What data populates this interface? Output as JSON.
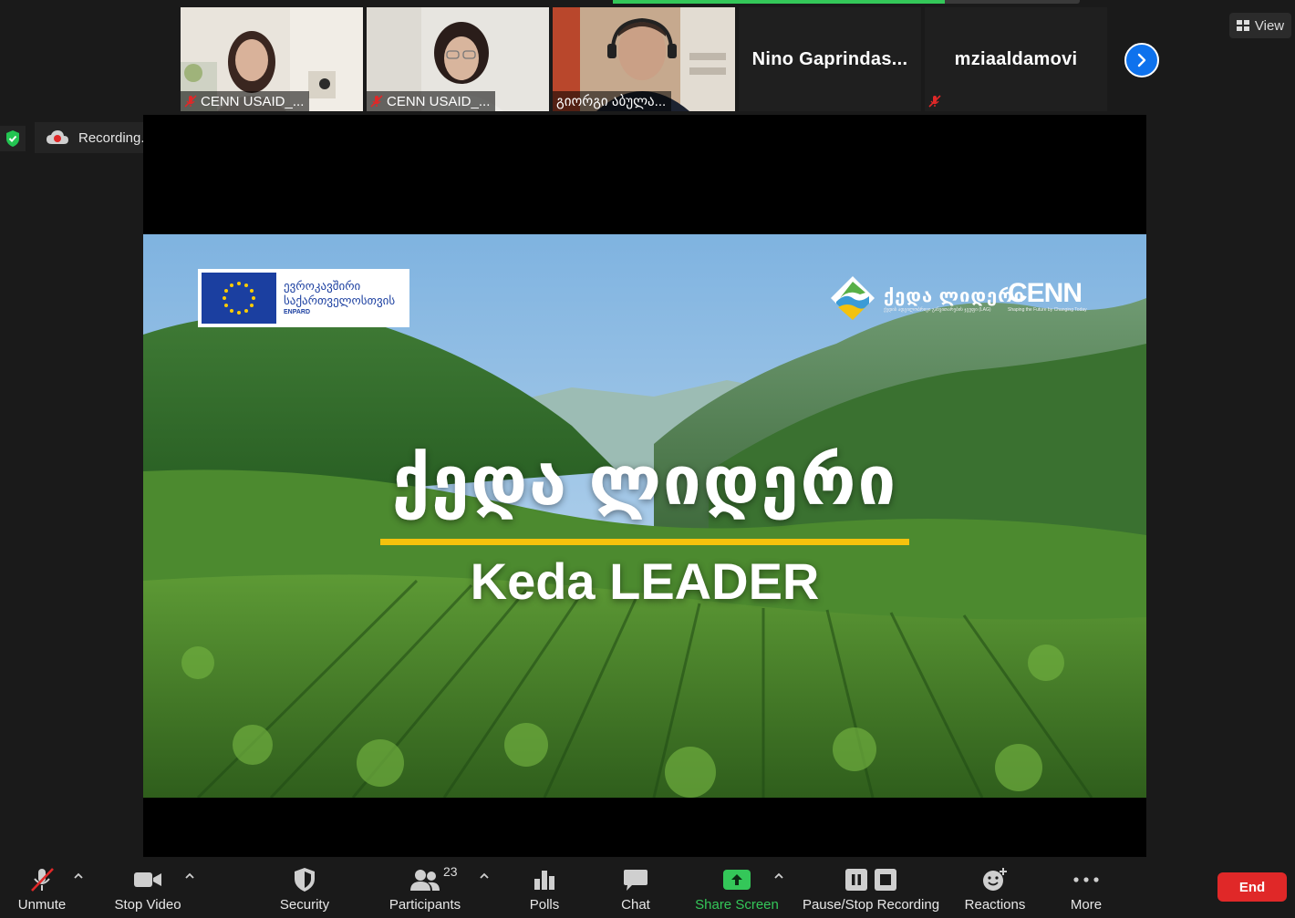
{
  "meeting": {
    "view_label": "View",
    "recording_label": "Recording..."
  },
  "gallery": {
    "tiles": [
      {
        "name": "CENN USAID_...",
        "muted": true,
        "video": true
      },
      {
        "name": "CENN USAID_...",
        "muted": true,
        "video": true
      },
      {
        "name": "გიორგი აბულა...",
        "muted": false,
        "video": true,
        "active": true
      },
      {
        "name": "Nino  Gaprindas...",
        "muted": false,
        "video": false
      },
      {
        "name": "mziaaldamovi",
        "muted": true,
        "video": false
      }
    ]
  },
  "slide": {
    "eu_line1": "ევროკავშირი",
    "eu_line2": "საქართველოსთვის",
    "eu_tag": "ENPARD",
    "keda_logo_text": "ქედა ლიდერი",
    "keda_logo_sub": "ქედის ადგილობრივი განვითარების ჯგუფი (LAG)",
    "cenn_logo_text": "CENN",
    "cenn_logo_sub": "Shaping the Future by Changing Today",
    "title_ka": "ქედა ლიდერი",
    "title_en": "Keda LEADER"
  },
  "toolbar": {
    "unmute": "Unmute",
    "stop_video": "Stop Video",
    "security": "Security",
    "participants": "Participants",
    "participants_count": "23",
    "polls": "Polls",
    "chat": "Chat",
    "share_screen": "Share Screen",
    "pause_stop_recording": "Pause/Stop Recording",
    "reactions": "Reactions",
    "more": "More",
    "end": "End"
  },
  "colors": {
    "accent_blue": "#0e72ed",
    "share_green": "#34c759",
    "end_red": "#e02828",
    "muted_red": "#e02828",
    "slide_rule_yellow": "#f4c20d"
  }
}
